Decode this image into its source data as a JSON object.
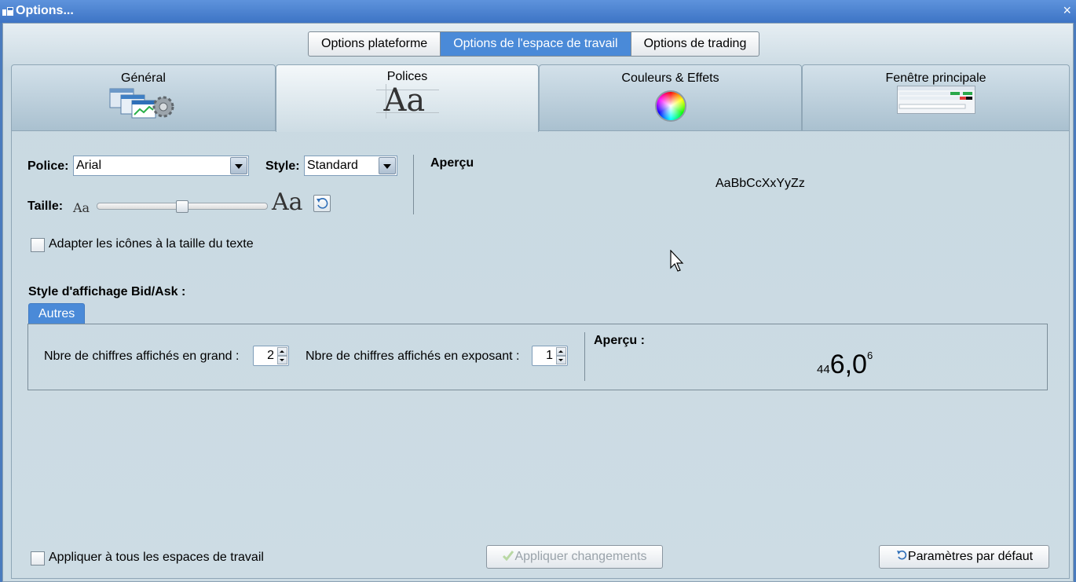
{
  "window": {
    "title": "Options...",
    "close_glyph": "×"
  },
  "top_tabs": {
    "items": [
      {
        "label": "Options plateforme",
        "active": false
      },
      {
        "label": "Options de l'espace de travail",
        "active": true
      },
      {
        "label": "Options de trading",
        "active": false
      }
    ]
  },
  "section_tabs": {
    "items": [
      {
        "label": "Général",
        "icon": "windows-gear-icon",
        "active": false
      },
      {
        "label": "Polices",
        "icon": "font-aa-icon",
        "active": true
      },
      {
        "label": "Couleurs & Effets",
        "icon": "color-wheel-icon",
        "active": false
      },
      {
        "label": "Fenêtre principale",
        "icon": "main-window-thumbnail-icon",
        "active": false
      }
    ],
    "polices_icon_text": "Aa"
  },
  "font": {
    "police_label": "Police:",
    "police_value": "Arial",
    "style_label": "Style:",
    "style_value": "Standard",
    "taille_label": "Taille:",
    "size_small_glyph": "Aa",
    "size_large_glyph": "Aa",
    "slider_level": 0.5,
    "apercu_label": "Aperçu",
    "apercu_text": "AaBbCcXxYyZz"
  },
  "adapt_icons": {
    "label": "Adapter les icônes à la taille du texte",
    "checked": false
  },
  "bidask": {
    "heading": "Style d'affichage Bid/Ask :",
    "subtab_label": "Autres",
    "big_digits_label": "Nbre de chiffres affichés en grand :",
    "big_digits_value": "2",
    "exp_digits_label": "Nbre de chiffres affichés en exposant :",
    "exp_digits_value": "1",
    "apercu_label": "Aperçu :",
    "preview_small": "44",
    "preview_big": "6,0",
    "preview_sup": "6"
  },
  "footer": {
    "apply_all_label": "Appliquer à tous les espaces de travail",
    "apply_all_checked": false,
    "apply_button_label": "Appliquer changements",
    "defaults_button_label": "Paramètres par défaut"
  },
  "colors": {
    "accent": "#4a8ad8",
    "titlebar": "#3d74c5",
    "panel": "#cddce4"
  }
}
